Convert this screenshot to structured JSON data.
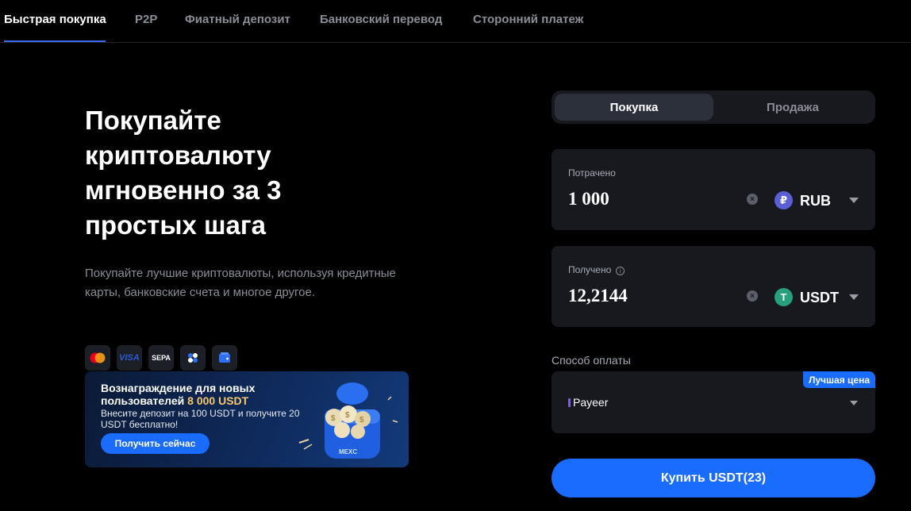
{
  "tabs": [
    {
      "label": "Быстрая покупка",
      "active": true
    },
    {
      "label": "P2P",
      "active": false
    },
    {
      "label": "Фиатный депозит",
      "active": false
    },
    {
      "label": "Банковский перевод",
      "active": false
    },
    {
      "label": "Сторонний платеж",
      "active": false
    }
  ],
  "hero": {
    "title": "Покупайте криптовалюту мгновенно за 3 простых шага",
    "subtitle": "Покупайте лучшие криптовалюты, используя кредитные карты, банковские счета и многое другое."
  },
  "payment_icons": [
    {
      "name": "mastercard-icon"
    },
    {
      "name": "visa-icon",
      "text": "VISA"
    },
    {
      "name": "sepa-icon",
      "text": "SEPA"
    },
    {
      "name": "dots-pay-icon"
    },
    {
      "name": "wallet-icon"
    }
  ],
  "promo": {
    "title_prefix": "Вознаграждение для новых пользователей",
    "title_amount": "8 000 USDT",
    "description": "Внесите депозит на 100 USDT и получите 20 USDT бесплатно!",
    "button": "Получить сейчас",
    "art_label": "MEXC"
  },
  "trade_toggle": {
    "buy": "Покупка",
    "sell": "Продажа",
    "active": "buy"
  },
  "spend": {
    "label": "Потрачено",
    "value": "1 000",
    "currency": "RUB",
    "coin_symbol": "₽",
    "coin_color": "#5b5fd6"
  },
  "receive": {
    "label": "Получено",
    "info_symbol": "i",
    "value": "12,2144",
    "currency": "USDT",
    "coin_symbol": "T",
    "coin_color": "#26a17b"
  },
  "payment_method": {
    "label": "Способ оплаты",
    "badge": "Лучшая цена",
    "selected": "Payeer"
  },
  "buy_button": "Купить USDT(23)",
  "colors": {
    "accent": "#1a6cff",
    "background": "#000000",
    "panel": "#17191f",
    "highlight": "#f7c86a"
  }
}
